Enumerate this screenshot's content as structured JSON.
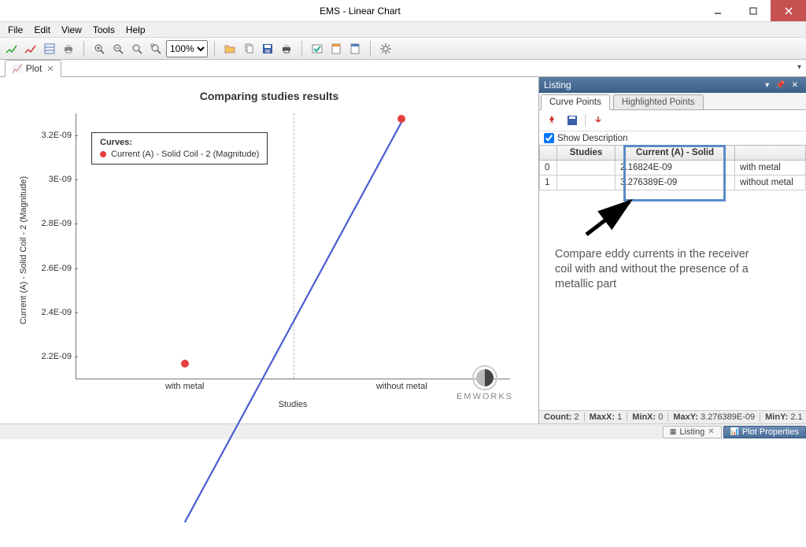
{
  "window": {
    "title": "EMS - Linear Chart"
  },
  "menu": [
    "File",
    "Edit",
    "View",
    "Tools",
    "Help"
  ],
  "toolbar": {
    "zoom": "100%"
  },
  "docTab": {
    "label": "Plot"
  },
  "chart": {
    "title": "Comparing studies results",
    "legend_title": "Curves:",
    "legend_item": "Current (A) - Solid Coil - 2 (Magnitude)",
    "x_axis": "Studies",
    "y_axis": "Current (A) - Solid Coil - 2 (Magnitude)",
    "y_ticks": [
      "2.2E-09",
      "2.4E-09",
      "2.6E-09",
      "2.8E-09",
      "3E-09",
      "3.2E-09"
    ],
    "x_ticks": [
      "with metal",
      "without metal"
    ]
  },
  "listing": {
    "title": "Listing",
    "tabs": {
      "curve": "Curve Points",
      "highlighted": "Highlighted Points"
    },
    "show_desc": "Show Description",
    "columns": {
      "studies": "Studies",
      "current": "Current (A) - Solid"
    },
    "rows": [
      {
        "idx": "0",
        "val": "2.16824E-09",
        "desc": "with metal"
      },
      {
        "idx": "1",
        "val": "3.276389E-09",
        "desc": "without metal"
      }
    ],
    "annotation": "Compare eddy currents in the receiver coil with and without the presence of a metallic part",
    "tab_listing": "Listing",
    "tab_props": "Plot Properties"
  },
  "stats": {
    "count_lbl": "Count:",
    "count": "2",
    "maxx_lbl": "MaxX:",
    "maxx": "1",
    "minx_lbl": "MinX:",
    "minx": "0",
    "maxy_lbl": "MaxY:",
    "maxy": "3.276389E-09",
    "miny_lbl": "MinY:",
    "miny": "2.1"
  },
  "brand": "EMWORKS",
  "chart_data": {
    "type": "line",
    "title": "Comparing studies results",
    "xlabel": "Studies",
    "ylabel": "Current (A) - Solid Coil - 2 (Magnitude)",
    "categories": [
      "with metal",
      "without metal"
    ],
    "series": [
      {
        "name": "Current (A) - Solid Coil - 2 (Magnitude)",
        "values": [
          2.16824e-09,
          3.276389e-09
        ]
      }
    ],
    "ylim": [
      2.1e-09,
      3.3e-09
    ]
  }
}
